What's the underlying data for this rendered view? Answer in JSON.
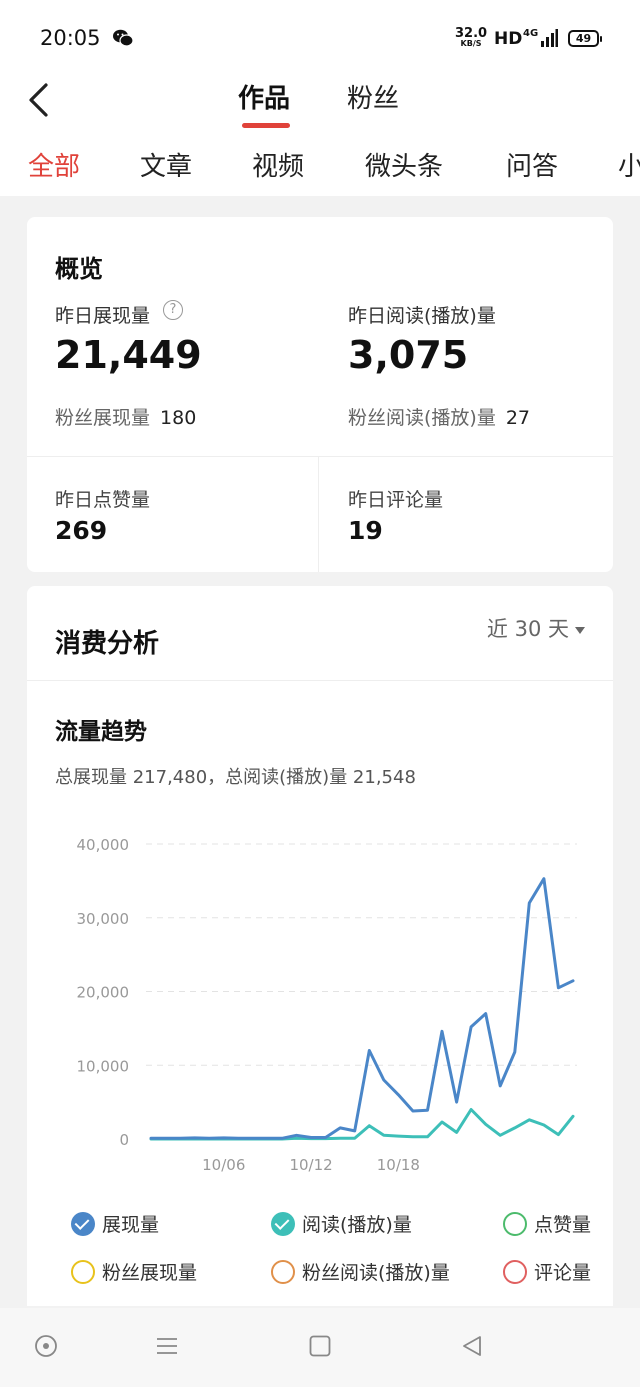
{
  "status_bar": {
    "time": "20:05",
    "speed": "32.0",
    "speed_unit": "KB/S",
    "hd": "HD",
    "network": "4G",
    "battery": "49"
  },
  "header": {
    "tabs": [
      {
        "label": "作品",
        "active": true
      },
      {
        "label": "粉丝",
        "active": false
      }
    ]
  },
  "categories": [
    "全部",
    "文章",
    "视频",
    "微头条",
    "问答",
    "小"
  ],
  "overview": {
    "title": "概览",
    "impressions": {
      "label": "昨日展现量",
      "value": "21,449",
      "sub_label": "粉丝展现量",
      "sub_value": "180"
    },
    "reads": {
      "label": "昨日阅读(播放)量",
      "value": "3,075",
      "sub_label": "粉丝阅读(播放)量",
      "sub_value": "27"
    },
    "likes": {
      "label": "昨日点赞量",
      "value": "269"
    },
    "comments": {
      "label": "昨日评论量",
      "value": "19"
    }
  },
  "analysis": {
    "title": "消费分析",
    "range": "近 30 天",
    "trend_title": "流量趋势",
    "summary": "总展现量 217,480，总阅读(播放)量 21,548"
  },
  "chart_data": {
    "type": "line",
    "title": "流量趋势",
    "x_tick_labels": [
      "10/06",
      "10/12",
      "10/18"
    ],
    "y_tick_labels": [
      "40,000",
      "30,000",
      "20,000",
      "10,000",
      "0"
    ],
    "ylim": [
      0,
      40000
    ],
    "grid": true,
    "legend_placement": "bottom",
    "x": [
      "10/01",
      "10/02",
      "10/03",
      "10/04",
      "10/05",
      "10/06",
      "10/07",
      "10/08",
      "10/09",
      "10/10",
      "10/11",
      "10/12",
      "10/13",
      "10/14",
      "10/15",
      "10/16",
      "10/17",
      "10/18",
      "10/19",
      "10/20",
      "10/21",
      "10/22",
      "10/23",
      "10/24",
      "10/25",
      "10/26",
      "10/27",
      "10/28",
      "10/29",
      "10/30"
    ],
    "series": [
      {
        "name": "展现量",
        "color": "#4a86c8",
        "visible": true,
        "values": [
          100,
          100,
          100,
          150,
          100,
          150,
          100,
          100,
          100,
          100,
          500,
          200,
          200,
          1500,
          1100,
          12000,
          8000,
          6000,
          3800,
          3900,
          14600,
          5000,
          15200,
          17000,
          7200,
          11800,
          32000,
          35300,
          20500,
          21449
        ]
      },
      {
        "name": "阅读(播放)量",
        "color": "#3dbfb8",
        "visible": true,
        "values": [
          0,
          0,
          0,
          0,
          0,
          0,
          0,
          0,
          0,
          0,
          100,
          50,
          50,
          100,
          100,
          1800,
          500,
          400,
          300,
          300,
          2300,
          900,
          4000,
          2000,
          500,
          1500,
          2600,
          1900,
          600,
          3075
        ]
      },
      {
        "name": "点赞量",
        "color": "#4cbb6c",
        "visible": false,
        "values": []
      },
      {
        "name": "粉丝展现量",
        "color": "#e8c21c",
        "visible": false,
        "values": []
      },
      {
        "name": "粉丝阅读(播放)量",
        "color": "#e0904a",
        "visible": false,
        "values": []
      },
      {
        "name": "评论量",
        "color": "#e06060",
        "visible": false,
        "values": []
      }
    ]
  },
  "nav": {
    "icons": [
      "home-circle-icon",
      "menu-icon",
      "square-icon",
      "back-triangle-icon"
    ]
  }
}
